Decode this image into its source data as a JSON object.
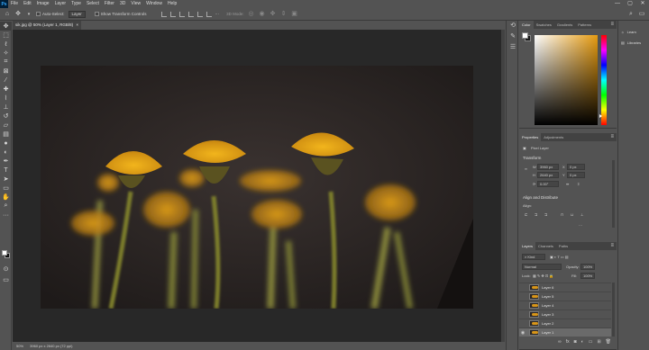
{
  "menubar": {
    "logo": "Ps",
    "items": [
      "File",
      "Edit",
      "Image",
      "Layer",
      "Type",
      "Select",
      "Filter",
      "3D",
      "View",
      "Window",
      "Help"
    ],
    "window_controls": [
      "—",
      "▢",
      "✕"
    ]
  },
  "options": {
    "auto_select_label": "Auto-Select:",
    "auto_select_target": "Layer",
    "show_transform_label": "Show Transform Controls",
    "mode_3d": "3D Mode:"
  },
  "document": {
    "tab_title": "sik.jpg @ 50% (Layer 1, RGB/8)",
    "close": "×"
  },
  "status": {
    "zoom": "50%",
    "dimensions": "3960 px x 2640 px (72 ppi)"
  },
  "color_panel": {
    "tabs": [
      "Color",
      "Swatches",
      "Gradients",
      "Patterns"
    ],
    "foreground": "#ffffff",
    "background": "#1a1a1a",
    "hue_color": "#e69b11"
  },
  "properties_panel": {
    "tabs": [
      "Properties",
      "Adjustments"
    ],
    "kind": "Pixel Layer",
    "transform_title": "Transform",
    "w_label": "W",
    "w_value": "3960 px",
    "h_label": "H",
    "h_value": "2640 px",
    "x_label": "X",
    "x_value": "0 px",
    "y_label": "Y",
    "y_value": "0 px",
    "angle": "0.00°",
    "align_title": "Align and Distribute",
    "align_label": "Align:",
    "more": "···"
  },
  "layers_panel": {
    "tabs": [
      "Layers",
      "Channels",
      "Paths"
    ],
    "kind_filter": "Kind",
    "blend_mode": "Normal",
    "opacity_label": "Opacity:",
    "opacity_value": "100%",
    "lock_label": "Lock:",
    "fill_label": "Fill:",
    "fill_value": "100%",
    "layers": [
      {
        "name": "Layer 6",
        "visible": false,
        "selected": false
      },
      {
        "name": "Layer 5",
        "visible": false,
        "selected": false
      },
      {
        "name": "Layer 4",
        "visible": false,
        "selected": false
      },
      {
        "name": "Layer 3",
        "visible": false,
        "selected": false
      },
      {
        "name": "Layer 2",
        "visible": false,
        "selected": false
      },
      {
        "name": "Layer 1",
        "visible": true,
        "selected": true
      }
    ]
  },
  "side_panel": {
    "learn": "Learn",
    "libraries": "Libraries"
  }
}
